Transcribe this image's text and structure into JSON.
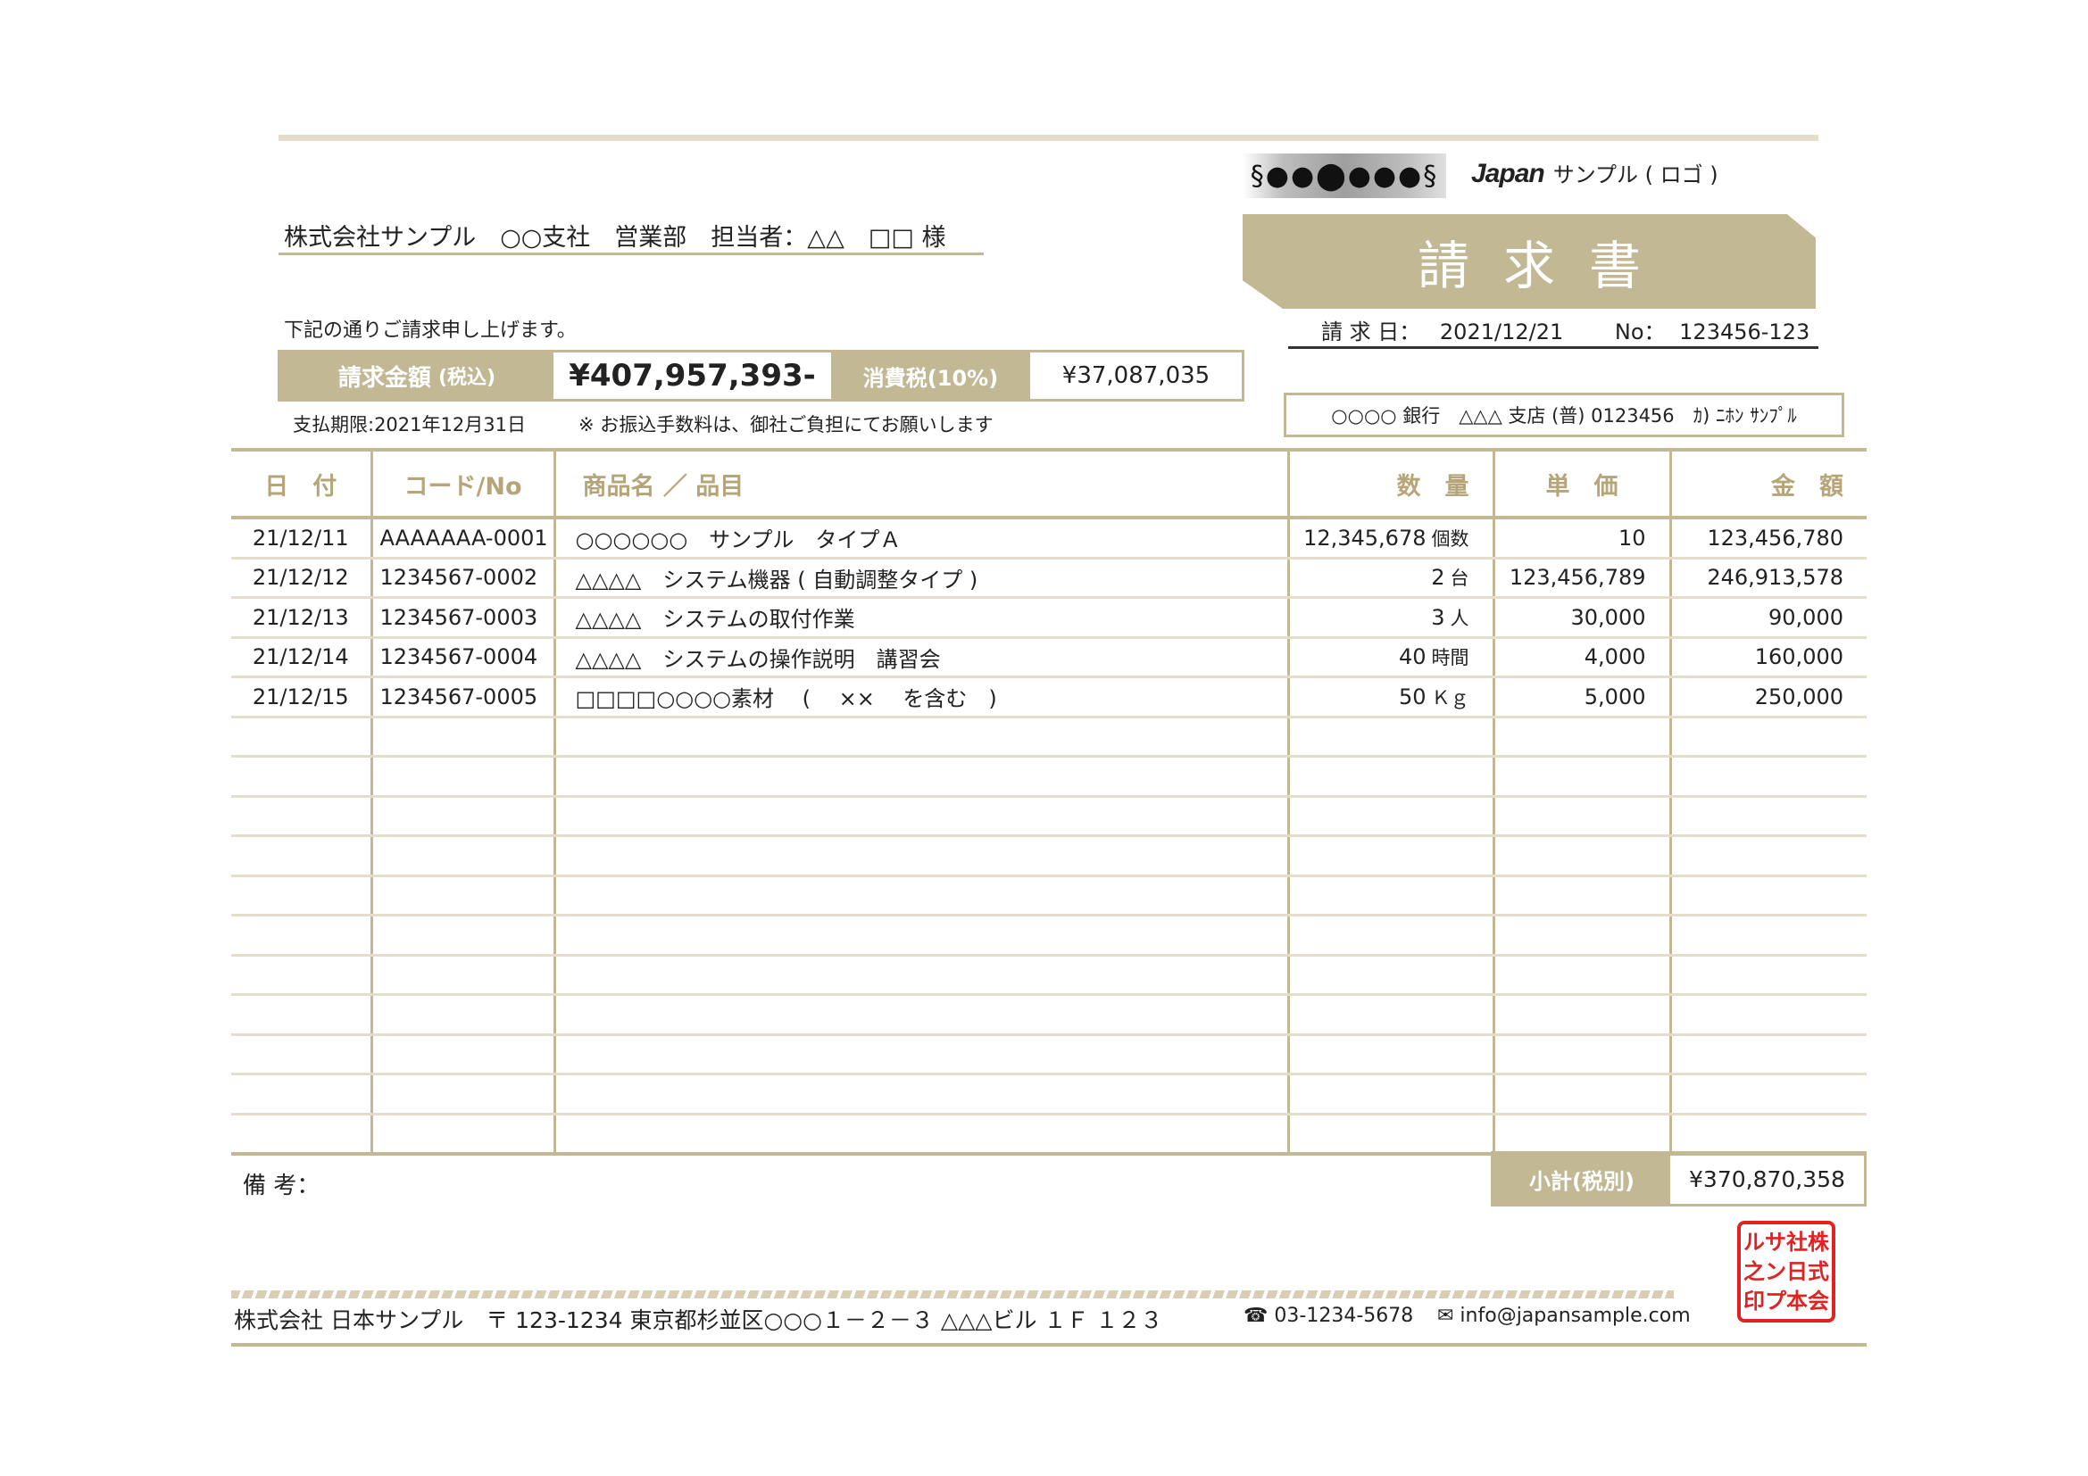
{
  "logo": {
    "mark": "§●●⬤●●●§",
    "brand": "Japan",
    "subtitle": "サンプル ( ロゴ )"
  },
  "customer": {
    "text": "株式会社サンプル　○○支社　営業部　担当者：△△　□□ 様"
  },
  "title": "請求書",
  "meta": {
    "date_label": "請 求 日：",
    "date": "2021/12/21",
    "no_label": "No：",
    "no": "123456-123"
  },
  "intro": "下記の通りご請求申し上げます。",
  "amount": {
    "label": "請求金額",
    "label_note": "(税込)",
    "value": "¥407,957,393-",
    "tax_label": "消費税(10%)",
    "tax_value": "¥37,087,035"
  },
  "deadline": "支払期限:2021年12月31日",
  "fee_note": "※ お振込手数料は、御社ご負担にてお願いします",
  "bank": "○○○○ 銀行　△△△ 支店 (普) 0123456　ｶ) ﾆﾎﾝ ｻﾝﾌﾟﾙ",
  "table": {
    "headers": [
      "日　付",
      "コード/No",
      "商品名 ／ 品目",
      "数　量",
      "単　価",
      "金　額"
    ],
    "rows": [
      {
        "date": "21/12/11",
        "code": "AAAAAAA-0001",
        "name": "○○○○○○　サンプル　タイプＡ",
        "qty": "12,345,678",
        "unit": "個数",
        "price": "10",
        "amount": "123,456,780"
      },
      {
        "date": "21/12/12",
        "code": "1234567-0002",
        "name": "△△△△　システム機器 ( 自動調整タイプ )",
        "qty": "2",
        "unit": "台",
        "price": "123,456,789",
        "amount": "246,913,578"
      },
      {
        "date": "21/12/13",
        "code": "1234567-0003",
        "name": "△△△△　システムの取付作業",
        "qty": "3",
        "unit": "人",
        "price": "30,000",
        "amount": "90,000"
      },
      {
        "date": "21/12/14",
        "code": "1234567-0004",
        "name": "△△△△　システムの操作説明　講習会",
        "qty": "40",
        "unit": "時間",
        "price": "4,000",
        "amount": "160,000"
      },
      {
        "date": "21/12/15",
        "code": "1234567-0005",
        "name": "□□□□○○○○素材　 (　 ×× 　を含む　)",
        "qty": "50",
        "unit": "Ｋｇ",
        "price": "5,000",
        "amount": "250,000"
      }
    ],
    "empty_rows": 11
  },
  "remarks_label": "備 考：",
  "subtotal": {
    "label": "小計(税別)",
    "value": "¥370,870,358"
  },
  "footer": {
    "company": "株式会社 日本サンプル　〒 123-1234 東京都杉並区○○○１－２－３ △△△ビル １Ｆ １２３",
    "tel": "☎ 03-1234-5678",
    "mail": "✉ info@japansample.com"
  },
  "seal": {
    "chars": [
      "株",
      "式",
      "会",
      "社",
      "日",
      "本",
      "サ",
      "ン",
      "プ",
      "ル",
      "之",
      "印"
    ]
  }
}
